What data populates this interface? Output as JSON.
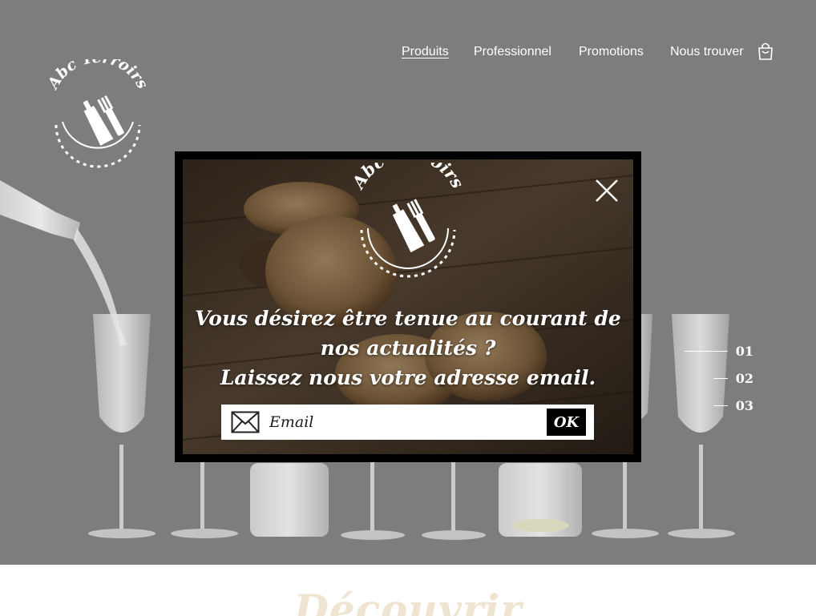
{
  "brand": {
    "logo_text": "Abc Terroirs"
  },
  "nav": {
    "items": [
      {
        "label": "Produits",
        "active": true
      },
      {
        "label": "Professionnel",
        "active": false
      },
      {
        "label": "Promotions",
        "active": false
      },
      {
        "label": "Nous trouver",
        "active": false
      }
    ],
    "cart_icon": "shopping-bag-icon"
  },
  "slider": {
    "pages": [
      "01",
      "02",
      "03"
    ],
    "active_index": 0
  },
  "newsletter_modal": {
    "logo_text": "Abc Terroirs",
    "message_line1": "Vous désirez être tenue au courant de",
    "message_line2": "nos actualités ?",
    "message_line3": "Laissez nous votre adresse email.",
    "email_placeholder": "Email",
    "email_value": "",
    "submit_label": "OK",
    "close_icon": "close-icon",
    "mail_icon": "envelope-icon"
  },
  "section": {
    "title": "Découvrir"
  },
  "colors": {
    "hero_overlay": "#7d7d7d",
    "modal_border": "#000000",
    "accent_cream": "#efe4cf",
    "text_light": "#ffffff"
  }
}
